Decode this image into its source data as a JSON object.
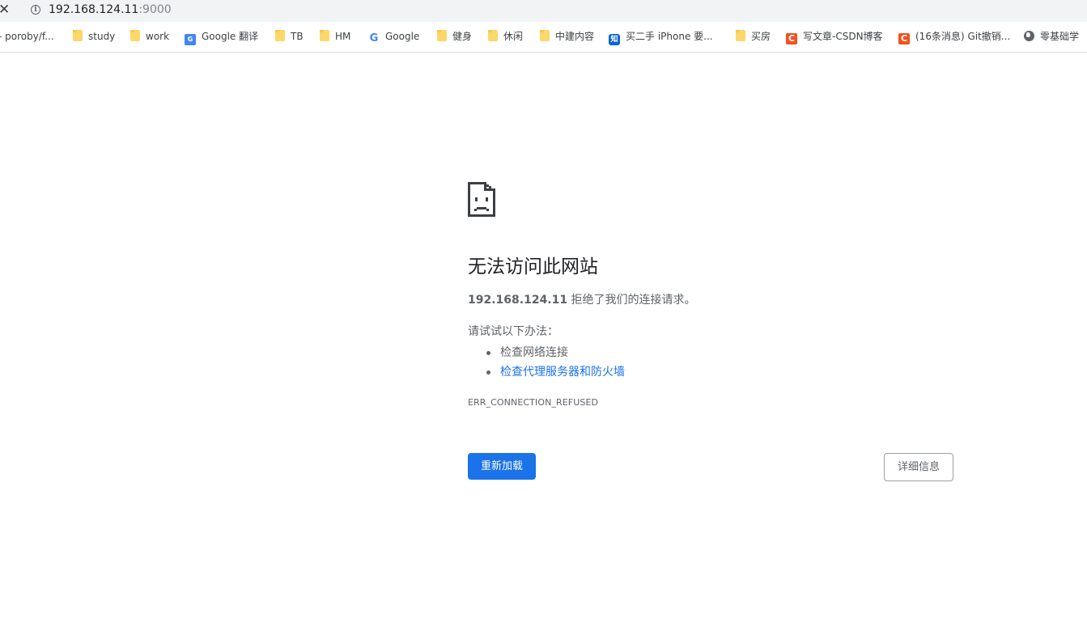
{
  "address_bar": {
    "close_glyph": "✕",
    "info_glyph": "i",
    "host": "192.168.124.11",
    "port": ":9000"
  },
  "bookmarks": [
    {
      "label": "- poroby/f...",
      "icon": "none"
    },
    {
      "label": "study",
      "icon": "folder-icon"
    },
    {
      "label": "work",
      "icon": "folder-icon"
    },
    {
      "label": "Google 翻译",
      "icon": "google-translate-icon"
    },
    {
      "label": "TB",
      "icon": "folder-icon"
    },
    {
      "label": "HM",
      "icon": "folder-icon"
    },
    {
      "label": "Google",
      "icon": "google-icon"
    },
    {
      "label": "健身",
      "icon": "folder-icon"
    },
    {
      "label": "休闲",
      "icon": "folder-icon"
    },
    {
      "label": "中建内容",
      "icon": "folder-icon"
    },
    {
      "label": "买二手 iPhone 要...",
      "icon": "zhihu-icon"
    },
    {
      "label": "买房",
      "icon": "folder-icon"
    },
    {
      "label": "写文章-CSDN博客",
      "icon": "csdn-icon"
    },
    {
      "label": "(16条消息) Git撤销...",
      "icon": "csdn-icon"
    },
    {
      "label": "零基础学",
      "icon": "globe-icon"
    }
  ],
  "icon_glyphs": {
    "google": "G",
    "google_translate": "G",
    "zhihu": "知",
    "csdn": "C"
  },
  "error": {
    "heading": "无法访问此网站",
    "host": "192.168.124.11",
    "summary_suffix": " 拒绝了我们的连接请求。",
    "try_label": "请试试以下办法：",
    "suggestions": [
      "检查网络连接",
      "检查代理服务器和防火墙"
    ],
    "code": "ERR_CONNECTION_REFUSED",
    "reload_label": "重新加载",
    "details_label": "详细信息"
  },
  "colors": {
    "primary_button": "#1a73e8",
    "link": "#1a73e8",
    "body_text": "#5f6368",
    "heading_text": "#202124"
  }
}
